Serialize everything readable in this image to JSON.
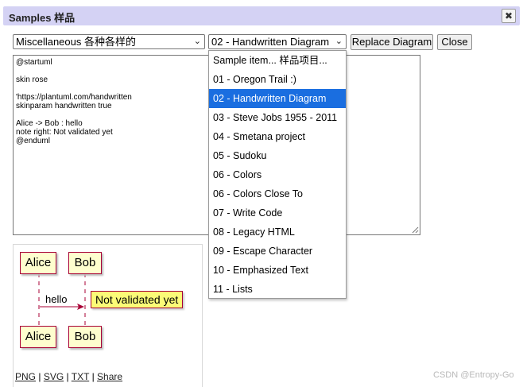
{
  "dialog": {
    "title": "Samples 样品",
    "close_glyph": "✖"
  },
  "toolbar": {
    "category_select": "Miscellaneous 各种各样的",
    "sample_select": "02 - Handwritten Diagram",
    "replace_label": "Replace Diagram",
    "close_label": "Close",
    "select_arrow_icon": "chevron-down-icon"
  },
  "editor": {
    "lines": [
      "@startuml",
      "",
      "skin rose",
      "",
      "'https://plantuml.com/handwritten",
      "skinparam handwritten true",
      "",
      "Alice -> Bob : hello",
      "note right: Not validated yet",
      "@enduml"
    ]
  },
  "dropdown": {
    "items": [
      "Sample item... 样品项目...",
      "01 - Oregon Trail :)",
      "02 - Handwritten Diagram",
      "03 - Steve Jobs 1955 - 2011",
      "04 - Smetana project",
      "05 - Sudoku",
      "06 - Colors",
      "06 - Colors Close To",
      "07 - Write Code",
      "08 - Legacy HTML",
      "09 - Escape Character",
      "10 - Emphasized Text",
      "11 - Lists"
    ],
    "selected_index": 2,
    "selected_color": "#1a6ee0"
  },
  "preview": {
    "actor_top_left": "Alice",
    "actor_top_right": "Bob",
    "actor_bottom_left": "Alice",
    "actor_bottom_right": "Bob",
    "message": "hello",
    "note": "Not validated yet",
    "actor_fill": "#fefece",
    "line_color": "#a80036",
    "note_fill": "#fbfb77"
  },
  "links": {
    "png": "PNG",
    "svg": "SVG",
    "txt": "TXT",
    "share": "Share",
    "sep": "|"
  },
  "watermark": "CSDN @Entropy-Go"
}
